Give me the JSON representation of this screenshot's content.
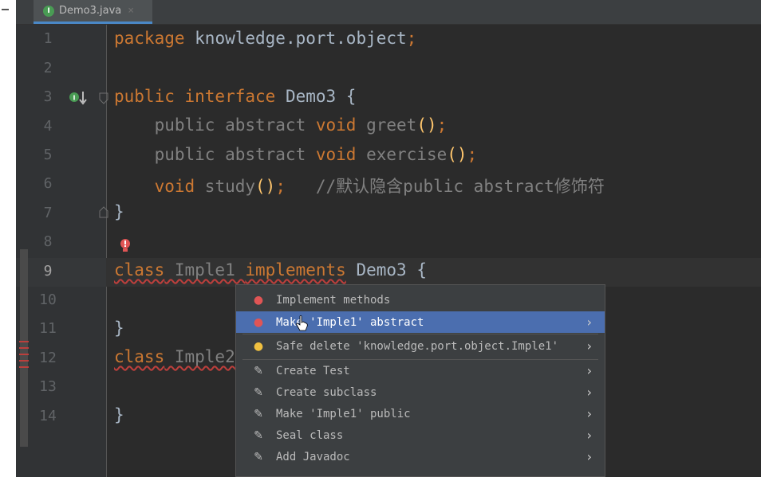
{
  "tab": {
    "icon_letter": "I",
    "file_name": "Demo3.java",
    "close_glyph": "×"
  },
  "line_numbers": [
    "1",
    "2",
    "3",
    "4",
    "5",
    "6",
    "7",
    "8",
    "9",
    "10",
    "11",
    "12",
    "13",
    "14"
  ],
  "code": {
    "l1_kw": "package",
    "l1_rest": " knowledge.port.object",
    "l1_semi": ";",
    "l3_kw": "public interface",
    "l3_rest": " Demo3 {",
    "l4_kw1": "    public abstract ",
    "l4_kw2": "void",
    "l4_fn": " greet",
    "l4_rest": "()",
    "l4_semi": ";",
    "l5_kw1": "    public abstract ",
    "l5_kw2": "void",
    "l5_fn": " exercise",
    "l5_rest": "()",
    "l5_semi": ";",
    "l6_kw": "    void",
    "l6_fn": " study",
    "l6_rest": "()",
    "l6_semi": ";",
    "l6_comment": "   //默认隐含public abstract修饰符",
    "l7": "}",
    "l9_kw1": "class",
    "l9_name": " Imple1 ",
    "l9_kw2": "implements",
    "l9_rest": " Demo3 {",
    "l11": "}",
    "l12_kw": "class",
    "l12_name": " Imple2",
    "l14": "}"
  },
  "popup": {
    "items": [
      {
        "label": "Implement methods",
        "icon": "error-bulb-icon",
        "arrow": ""
      },
      {
        "label": "Make 'Imple1' abstract",
        "icon": "error-bulb-icon",
        "arrow": "›"
      },
      {
        "label": "Safe delete 'knowledge.port.object.Imple1'",
        "icon": "bulb-icon",
        "arrow": "›"
      },
      {
        "label": "Create Test",
        "icon": "wand-icon",
        "arrow": "›"
      },
      {
        "label": "Create subclass",
        "icon": "wand-icon",
        "arrow": "›"
      },
      {
        "label": "Make 'Imple1' public",
        "icon": "wand-icon",
        "arrow": "›"
      },
      {
        "label": "Seal class",
        "icon": "wand-icon",
        "arrow": "›"
      },
      {
        "label": "Add Javadoc",
        "icon": "wand-icon",
        "arrow": "›"
      }
    ]
  },
  "colors": {
    "keyword": "#cc7832",
    "function": "#ffc66d",
    "text": "#a9b7c6",
    "comment": "#808080",
    "selection": "#4b6eaf",
    "error": "#bc3f3c"
  }
}
